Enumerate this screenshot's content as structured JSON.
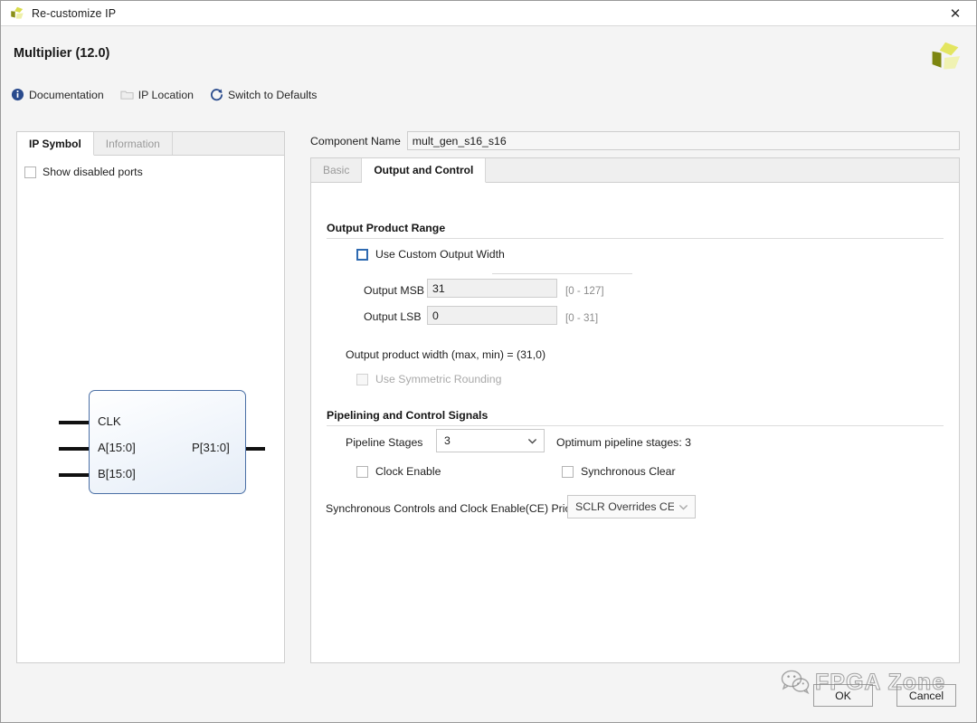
{
  "window": {
    "title": "Re-customize IP",
    "close_label": "✕",
    "app_icon": "xilinx-logo-icon"
  },
  "header": {
    "title": "Multiplier (12.0)",
    "logo_icon": "xilinx-pinwheel-logo"
  },
  "toolbar": {
    "items": [
      {
        "label": "Documentation",
        "icon": "info-icon",
        "enabled": true
      },
      {
        "label": "IP Location",
        "icon": "folder-icon",
        "enabled": false
      },
      {
        "label": "Switch to Defaults",
        "icon": "refresh-icon",
        "enabled": true
      }
    ]
  },
  "left_panel": {
    "tabs": [
      {
        "label": "IP Symbol",
        "active": true
      },
      {
        "label": "Information",
        "active": false
      }
    ],
    "show_disabled_ports": {
      "label": "Show disabled ports",
      "checked": false
    },
    "symbol": {
      "left_ports": [
        "CLK",
        "A[15:0]",
        "B[15:0]"
      ],
      "right_ports": [
        "P[31:0]"
      ]
    }
  },
  "component": {
    "label": "Component Name",
    "value": "mult_gen_s16_s16"
  },
  "right_panel": {
    "tabs": [
      {
        "label": "Basic",
        "active": false
      },
      {
        "label": "Output and Control",
        "active": true
      }
    ],
    "output_product_range": {
      "section_label": "Output Product Range",
      "use_custom_output_width": {
        "label": "Use Custom Output Width",
        "checked": false
      },
      "output_msb": {
        "label": "Output MSB",
        "value": "31",
        "range": "[0 - 127]"
      },
      "output_lsb": {
        "label": "Output LSB",
        "value": "0",
        "range": "[0 - 31]"
      },
      "width_summary": "Output product width (max, min) = (31,0)",
      "use_symmetric_rounding": {
        "label": "Use Symmetric Rounding",
        "checked": false,
        "enabled": false
      }
    },
    "pipelining": {
      "section_label": "Pipelining and Control Signals",
      "pipeline_stages": {
        "label": "Pipeline Stages",
        "value": "3"
      },
      "optimum_note": "Optimum pipeline stages: 3",
      "clock_enable": {
        "label": "Clock Enable",
        "checked": false
      },
      "synchronous_clear": {
        "label": "Synchronous Clear",
        "checked": false
      },
      "priority": {
        "label": "Synchronous Controls and Clock Enable(CE) Priority",
        "value": "SCLR Overrides CE"
      }
    }
  },
  "footer": {
    "ok_label": "OK",
    "cancel_label": "Cancel"
  },
  "watermark": {
    "text": "FPGA Zone",
    "icon": "wechat-icon"
  }
}
